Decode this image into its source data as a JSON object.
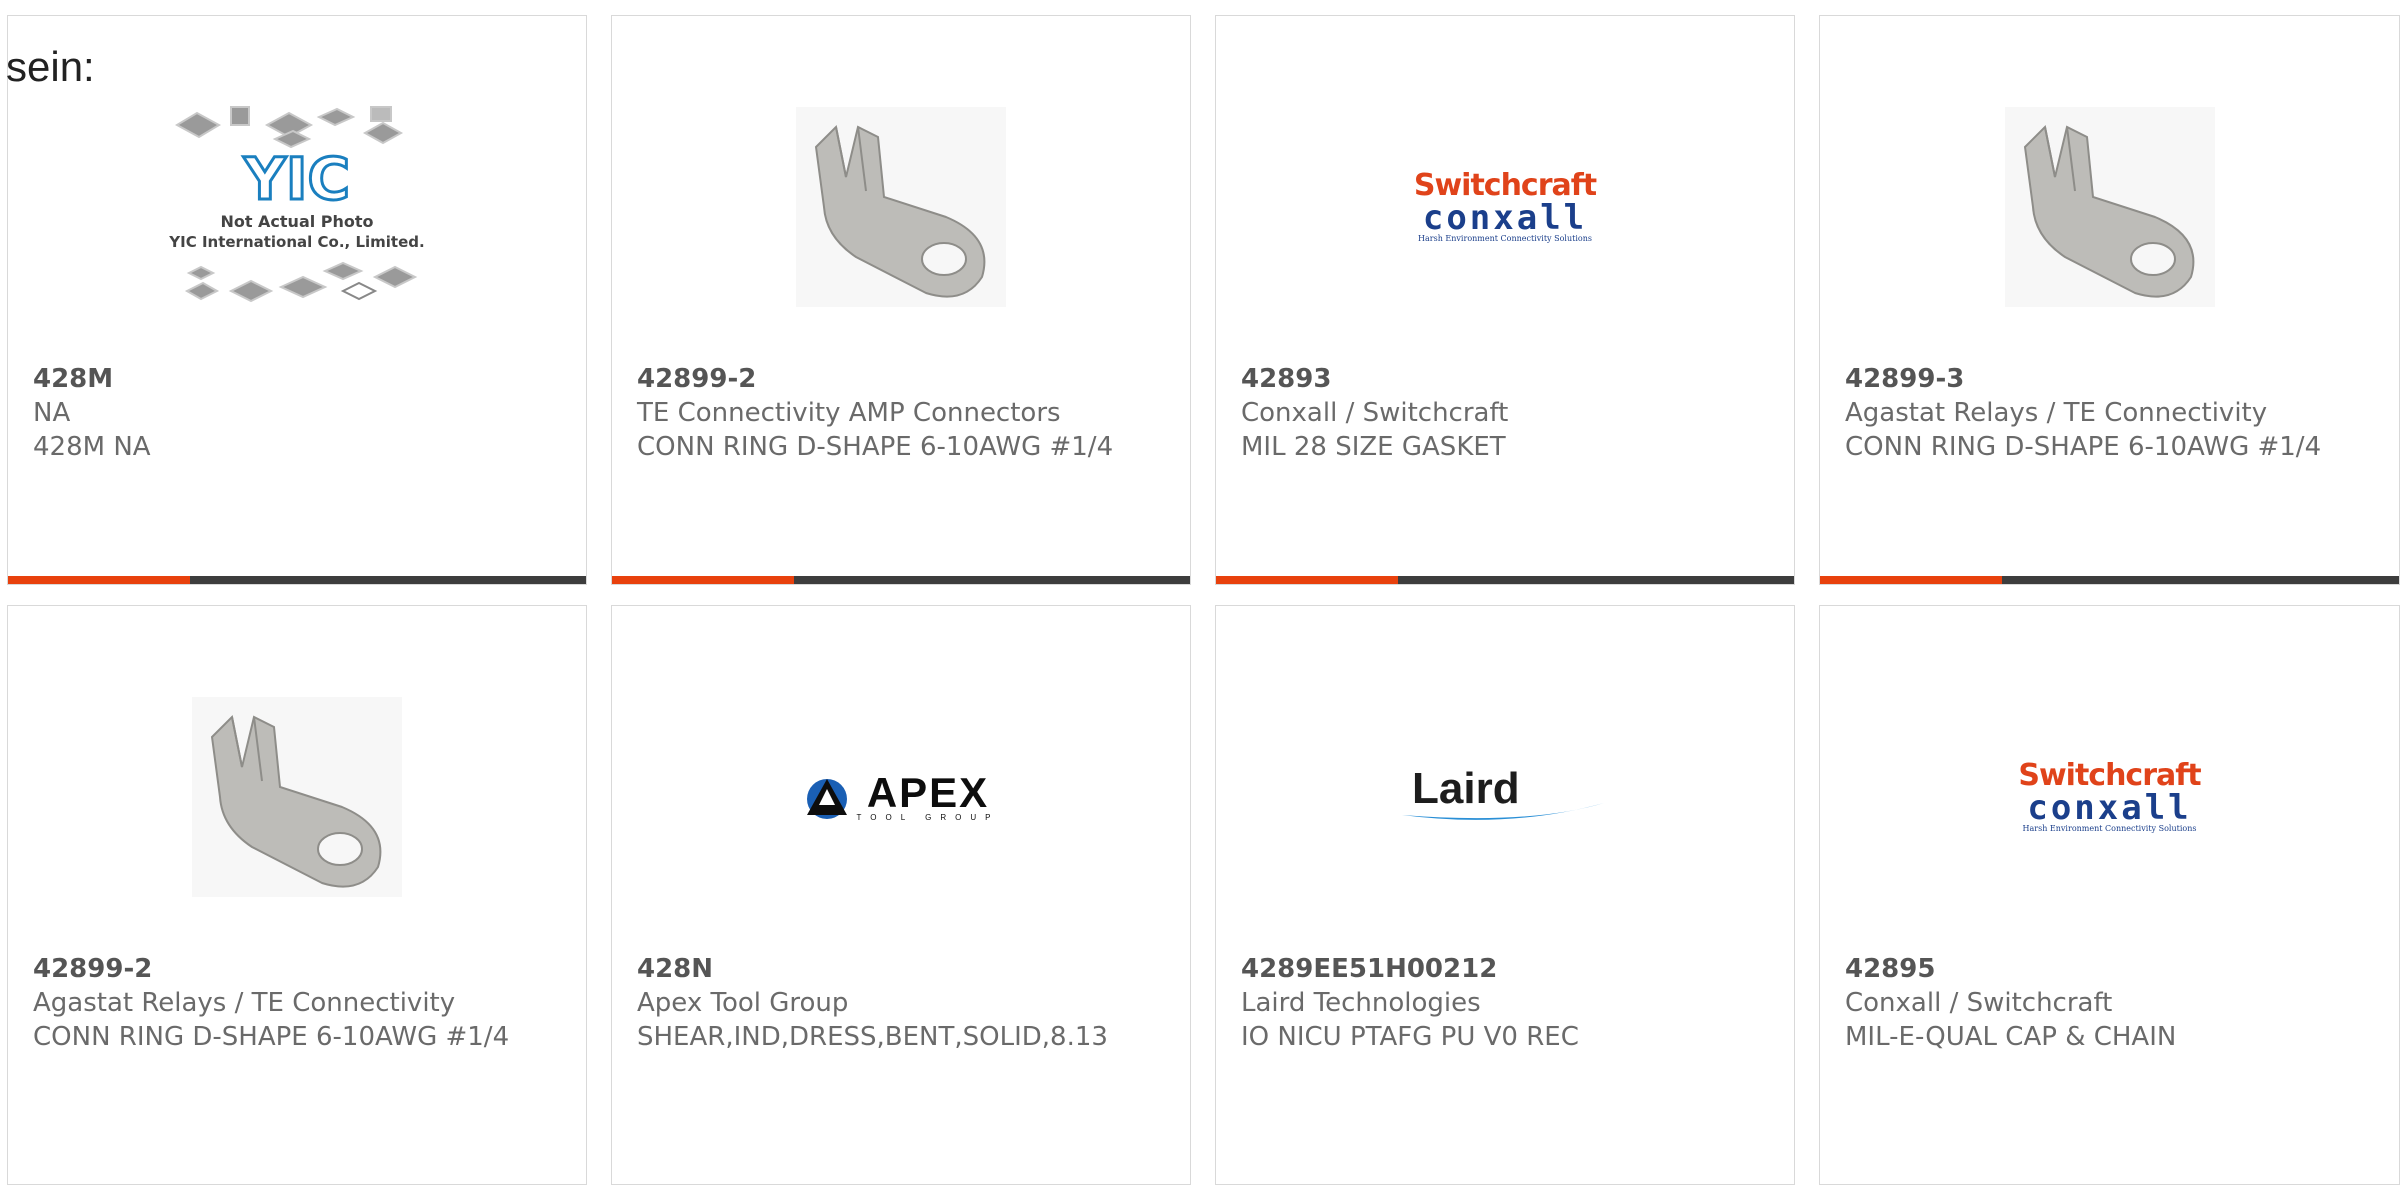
{
  "intro": "sein:",
  "colors": {
    "accent": "#e8410d",
    "bar": "#3d3d3d",
    "border": "#d9d9d9"
  },
  "cards": [
    {
      "part_number": "428M",
      "manufacturer": "NA",
      "description": "428M NA",
      "image": "not-actual-photo-placeholder",
      "placeholder_caption_1": "Not Actual Photo",
      "placeholder_caption_2": "YIC International Co., Limited.",
      "placeholder_logo": "YIC"
    },
    {
      "part_number": "42899-2",
      "manufacturer": "TE Connectivity AMP Connectors",
      "description": "CONN RING D-SHAPE 6-10AWG #1/4",
      "image": "ring-terminal-photo"
    },
    {
      "part_number": "42893",
      "manufacturer": "Conxall / Switchcraft",
      "description": "MIL 28 SIZE GASKET",
      "image": "switchcraft-conxall-logo",
      "logo_line_1": "Switchcraft",
      "logo_line_2": "conxall",
      "logo_tagline": "Harsh Environment Connectivity Solutions"
    },
    {
      "part_number": "42899-3",
      "manufacturer": "Agastat Relays / TE Connectivity",
      "description": "CONN RING D-SHAPE 6-10AWG #1/4",
      "image": "ring-terminal-photo"
    },
    {
      "part_number": "42899-2",
      "manufacturer": "Agastat Relays / TE Connectivity",
      "description": "CONN RING D-SHAPE 6-10AWG #1/4",
      "image": "ring-terminal-photo"
    },
    {
      "part_number": "428N",
      "manufacturer": "Apex Tool Group",
      "description": "SHEAR,IND,DRESS,BENT,SOLID,8.13",
      "image": "apex-tool-group-logo",
      "logo_line_1": "APEX",
      "logo_line_2": "TOOL GROUP"
    },
    {
      "part_number": "4289EE51H00212",
      "manufacturer": "Laird Technologies",
      "description": "IO NICU PTAFG PU V0 REC",
      "image": "laird-logo",
      "logo_line_1": "Laird"
    },
    {
      "part_number": "42895",
      "manufacturer": "Conxall / Switchcraft",
      "description": "MIL-E-QUAL CAP & CHAIN",
      "image": "switchcraft-conxall-logo",
      "logo_line_1": "Switchcraft",
      "logo_line_2": "conxall",
      "logo_tagline": "Harsh Environment Connectivity Solutions"
    }
  ]
}
